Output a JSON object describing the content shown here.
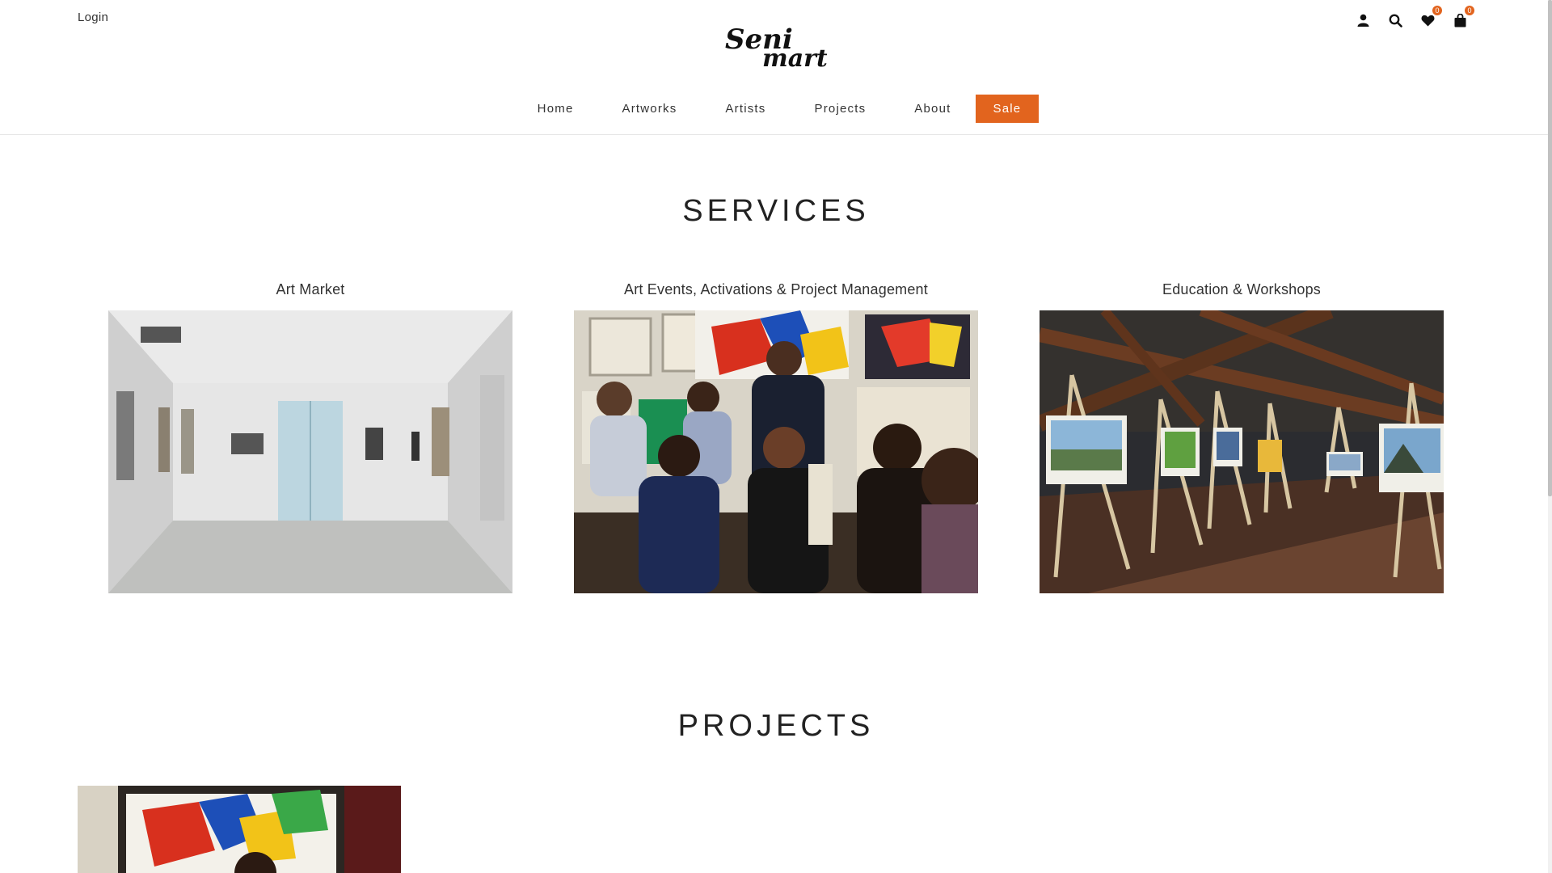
{
  "header": {
    "login_label": "Login",
    "logo_line1": "Seni",
    "logo_line2": "mart",
    "wishlist_count": "0",
    "cart_count": "0",
    "icons": [
      "user-icon",
      "search-icon",
      "heart-icon",
      "bag-icon"
    ]
  },
  "nav": {
    "items": [
      "Home",
      "Artworks",
      "Artists",
      "Projects",
      "About"
    ],
    "sale_label": "Sale"
  },
  "services": {
    "title": "SERVICES",
    "cards": [
      {
        "title": "Art Market"
      },
      {
        "title": "Art Events, Activations & Project Management"
      },
      {
        "title": "Education & Workshops"
      }
    ]
  },
  "projects": {
    "title": "PROJECTS"
  },
  "colors": {
    "accent": "#e2641e",
    "text": "#333333"
  }
}
